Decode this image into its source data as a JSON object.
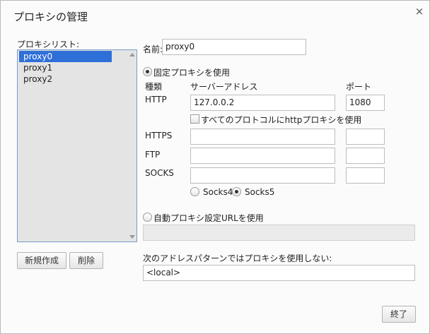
{
  "dialog": {
    "title": "プロキシの管理",
    "close_glyph": "×"
  },
  "proxy_list": {
    "label": "プロキシリスト:",
    "items": [
      "proxy0",
      "proxy1",
      "proxy2"
    ],
    "selected_index": 0
  },
  "list_buttons": {
    "new": "新規作成",
    "delete": "削除"
  },
  "name_field": {
    "label": "名前:",
    "value": "proxy0"
  },
  "fixed_proxy": {
    "radio_label": "固定プロキシを使用",
    "selected": true,
    "col_type": "種類",
    "col_server": "サーバーアドレス",
    "col_port": "ポート",
    "rows": [
      {
        "type": "HTTP",
        "server": "127.0.0.2",
        "port": "1080"
      },
      {
        "type": "HTTPS",
        "server": "",
        "port": ""
      },
      {
        "type": "FTP",
        "server": "",
        "port": ""
      },
      {
        "type": "SOCKS",
        "server": "",
        "port": ""
      }
    ],
    "use_http_for_all_label": "すべてのプロトコルにhttpプロキシを使用",
    "use_http_for_all_checked": false,
    "socks4_label": "Socks4",
    "socks5_label": "Socks5",
    "socks_version": "Socks5"
  },
  "auto_proxy": {
    "radio_label": "自動プロキシ設定URLを使用",
    "selected": false,
    "url_value": ""
  },
  "bypass": {
    "label": "次のアドレスパターンではプロキシを使用しない:",
    "value": "<local>"
  },
  "footer": {
    "done": "終了"
  }
}
